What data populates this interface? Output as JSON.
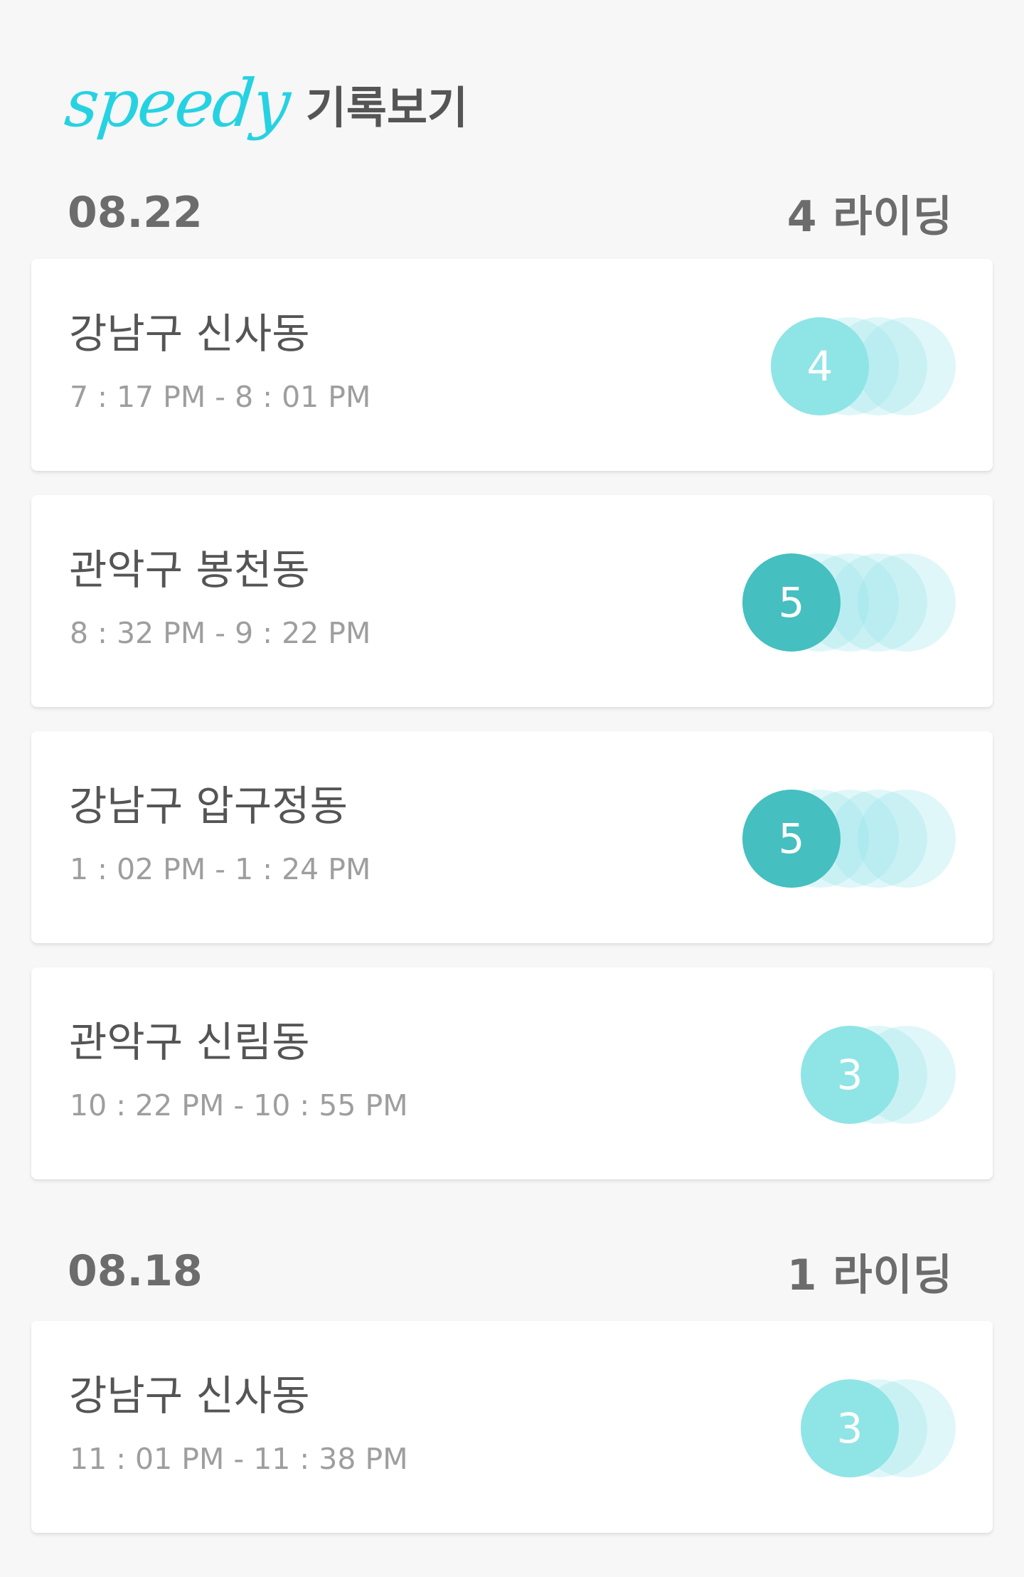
{
  "header": {
    "logo": "speedy",
    "title": "기록보기"
  },
  "sections": [
    {
      "date": "08.22",
      "count_label": "4 라이딩",
      "rides": [
        {
          "place": "강남구 신사동",
          "time": "7 : 17 PM - 8 : 01 PM",
          "count": "4",
          "badge_color": "#8fe4e6"
        },
        {
          "place": "관악구 봉천동",
          "time": "8 : 32 PM - 9 : 22 PM",
          "count": "5",
          "badge_color": "#45bfbf"
        },
        {
          "place": "강남구 압구정동",
          "time": "1 : 02 PM - 1 : 24 PM",
          "count": "5",
          "badge_color": "#45bfbf"
        },
        {
          "place": "관악구 신림동",
          "time": "10 : 22 PM - 10 : 55 PM",
          "count": "3",
          "badge_color": "#8fe4e6"
        }
      ]
    },
    {
      "date": "08.18",
      "count_label": "1 라이딩",
      "rides": [
        {
          "place": "강남구 신사동",
          "time": "11 : 01 PM - 11 : 38 PM",
          "count": "3",
          "badge_color": "#8fe4e6"
        }
      ]
    }
  ],
  "colors": {
    "brand": "#26d2e2",
    "background": "#f7f7f7",
    "badge_light": "#8fe4e6",
    "badge_dark": "#45bfbf"
  }
}
